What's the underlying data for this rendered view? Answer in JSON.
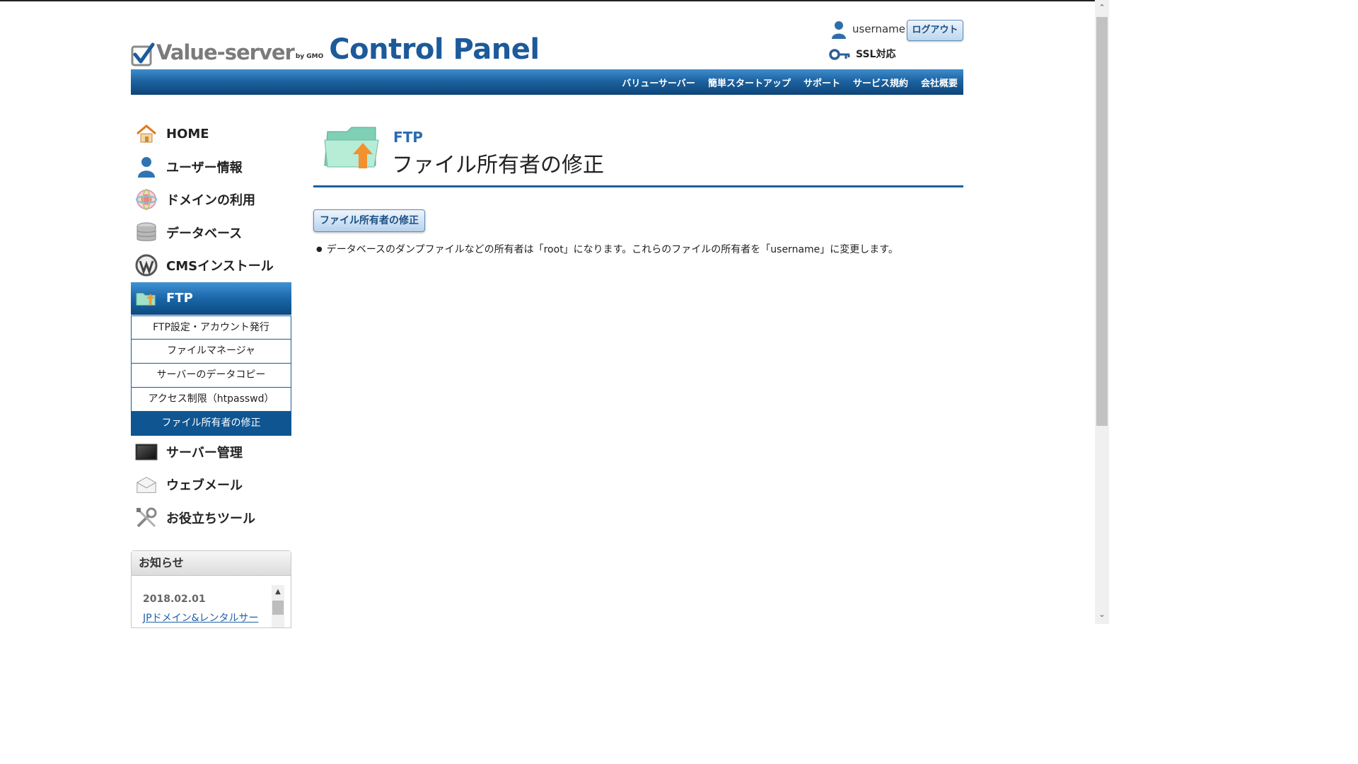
{
  "header": {
    "logo_text": "Value-server",
    "logo_sub": "by GMO",
    "logo_title": "Control Panel",
    "username": "username",
    "logout_label": "ログアウト",
    "ssl_label": "SSL対応"
  },
  "nav": {
    "items": [
      "バリューサーバー",
      "簡単スタートアップ",
      "サポート",
      "サービス規約",
      "会社概要"
    ]
  },
  "sidebar": {
    "items": [
      {
        "label": "HOME",
        "icon": "home-icon"
      },
      {
        "label": "ユーザー情報",
        "icon": "user-icon"
      },
      {
        "label": "ドメインの利用",
        "icon": "globe-icon"
      },
      {
        "label": "データベース",
        "icon": "database-icon"
      },
      {
        "label": "CMSインストール",
        "icon": "wordpress-icon"
      },
      {
        "label": "FTP",
        "icon": "folder-upload-icon",
        "active": true
      },
      {
        "label": "サーバー管理",
        "icon": "server-icon"
      },
      {
        "label": "ウェブメール",
        "icon": "envelope-icon"
      },
      {
        "label": "お役立ちツール",
        "icon": "tools-icon"
      }
    ],
    "ftp_submenu": [
      {
        "label": "FTP設定・アカウント発行"
      },
      {
        "label": "ファイルマネージャ"
      },
      {
        "label": "サーバーのデータコピー"
      },
      {
        "label": "アクセス制限（htpasswd）"
      },
      {
        "label": "ファイル所有者の修正",
        "current": true
      }
    ]
  },
  "news": {
    "heading": "お知らせ",
    "date": "2018.02.01",
    "link_text": "JPドメイン&レンタルサー"
  },
  "main": {
    "section": "FTP",
    "title": "ファイル所有者の修正",
    "button_label": "ファイル所有者の修正",
    "note": "データベースのダンプファイルなどの所有者は「root」になります。これらのファイルの所有者を「username」に変更します。"
  },
  "colors": {
    "accent": "#1c5f9f",
    "nav_dark": "#0e4477",
    "link": "#1f5fa8"
  }
}
